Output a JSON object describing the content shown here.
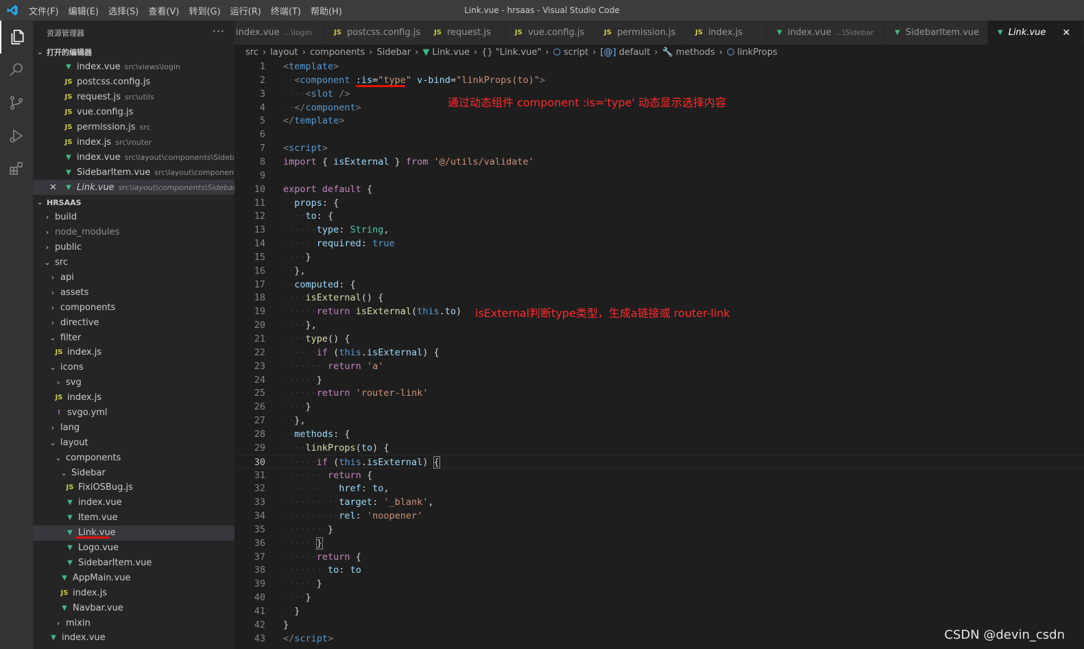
{
  "titlebar": {
    "menu": [
      "文件(F)",
      "编辑(E)",
      "选择(S)",
      "查看(V)",
      "转到(G)",
      "运行(R)",
      "终端(T)",
      "帮助(H)"
    ],
    "title": "Link.vue - hrsaas - Visual Studio Code"
  },
  "sidebar": {
    "title": "资源管理器",
    "more": "···",
    "open_editors_label": "打开的编辑器",
    "open_editors": [
      {
        "icon": "vue",
        "name": "index.vue",
        "desc": "src\\views\\login"
      },
      {
        "icon": "js",
        "name": "postcss.config.js",
        "desc": ""
      },
      {
        "icon": "js",
        "name": "request.js",
        "desc": "src\\utils"
      },
      {
        "icon": "js",
        "name": "vue.config.js",
        "desc": ""
      },
      {
        "icon": "js",
        "name": "permission.js",
        "desc": "src"
      },
      {
        "icon": "js",
        "name": "index.js",
        "desc": "src\\router"
      },
      {
        "icon": "vue",
        "name": "index.vue",
        "desc": "src\\layout\\components\\Sidebar"
      },
      {
        "icon": "vue",
        "name": "SidebarItem.vue",
        "desc": "src\\layout\\components\\..."
      },
      {
        "icon": "vue",
        "name": "Link.vue",
        "desc": "src\\layout\\components\\Sidebar",
        "active": true
      }
    ],
    "project_label": "HRSAAS",
    "tree": [
      {
        "indent": 0,
        "chev": "›",
        "name": "build"
      },
      {
        "indent": 0,
        "chev": "›",
        "name": "node_modules",
        "dim": true
      },
      {
        "indent": 0,
        "chev": "›",
        "name": "public"
      },
      {
        "indent": 0,
        "chev": "⌄",
        "name": "src"
      },
      {
        "indent": 1,
        "chev": "›",
        "name": "api"
      },
      {
        "indent": 1,
        "chev": "›",
        "name": "assets"
      },
      {
        "indent": 1,
        "chev": "›",
        "name": "components"
      },
      {
        "indent": 1,
        "chev": "›",
        "name": "directive"
      },
      {
        "indent": 1,
        "chev": "⌄",
        "name": "filter"
      },
      {
        "indent": 2,
        "icon": "js",
        "name": "index.js"
      },
      {
        "indent": 1,
        "chev": "⌄",
        "name": "icons"
      },
      {
        "indent": 2,
        "chev": "›",
        "name": "svg"
      },
      {
        "indent": 2,
        "icon": "js",
        "name": "index.js"
      },
      {
        "indent": 2,
        "icon": "yml",
        "name": "svgo.yml"
      },
      {
        "indent": 1,
        "chev": "›",
        "name": "lang"
      },
      {
        "indent": 1,
        "chev": "⌄",
        "name": "layout"
      },
      {
        "indent": 2,
        "chev": "⌄",
        "name": "components"
      },
      {
        "indent": 3,
        "chev": "⌄",
        "name": "Sidebar"
      },
      {
        "indent": 4,
        "icon": "js",
        "name": "FixiOSBug.js"
      },
      {
        "indent": 4,
        "icon": "vue",
        "name": "index.vue"
      },
      {
        "indent": 4,
        "icon": "vue",
        "name": "Item.vue"
      },
      {
        "indent": 4,
        "icon": "vue",
        "name": "Link.vue",
        "selected": true
      },
      {
        "indent": 4,
        "icon": "vue",
        "name": "Logo.vue"
      },
      {
        "indent": 4,
        "icon": "vue",
        "name": "SidebarItem.vue"
      },
      {
        "indent": 3,
        "icon": "vue",
        "name": "AppMain.vue"
      },
      {
        "indent": 3,
        "icon": "js",
        "name": "index.js"
      },
      {
        "indent": 3,
        "icon": "vue",
        "name": "Navbar.vue"
      },
      {
        "indent": 2,
        "chev": "›",
        "name": "mixin"
      },
      {
        "indent": 1,
        "icon": "vue",
        "name": "index.vue"
      }
    ]
  },
  "tabs": [
    {
      "icon": "",
      "name": "index.vue",
      "desc": "...\\login"
    },
    {
      "icon": "js",
      "name": "postcss.config.js",
      "desc": ""
    },
    {
      "icon": "js",
      "name": "request.js",
      "desc": ""
    },
    {
      "icon": "js",
      "name": "vue.config.js",
      "desc": ""
    },
    {
      "icon": "js",
      "name": "permission.js",
      "desc": ""
    },
    {
      "icon": "js",
      "name": "index.js",
      "desc": ""
    },
    {
      "icon": "vue",
      "name": "index.vue",
      "desc": "...\\Sidebar"
    },
    {
      "icon": "vue",
      "name": "SidebarItem.vue",
      "desc": ""
    },
    {
      "icon": "vue",
      "name": "Link.vue",
      "desc": "",
      "active": true,
      "close": "✕"
    }
  ],
  "breadcrumb": [
    {
      "label": "src"
    },
    {
      "label": "layout"
    },
    {
      "label": "components"
    },
    {
      "label": "Sidebar"
    },
    {
      "label": "Link.vue",
      "icon": "vue"
    },
    {
      "label": "\"Link.vue\"",
      "icon": "{}"
    },
    {
      "label": "script",
      "icon": "⬡"
    },
    {
      "label": "default",
      "icon": "[@]"
    },
    {
      "label": "methods",
      "icon": "🔧"
    },
    {
      "label": "linkProps",
      "icon": "⬡"
    }
  ],
  "editor": {
    "current_line": 30,
    "lines": [
      [
        [
          "t-punc",
          "<"
        ],
        [
          "t-tag",
          "template"
        ],
        [
          "t-punc",
          ">"
        ]
      ],
      [
        [
          "t-ws",
          "··"
        ],
        [
          "t-punc",
          "<"
        ],
        [
          "t-tag",
          "component"
        ],
        [
          "t-plain",
          " "
        ],
        [
          "t-attr",
          ":is"
        ],
        [
          "t-plain",
          "="
        ],
        [
          "t-str",
          "\"type\""
        ],
        [
          "t-plain",
          " "
        ],
        [
          "t-attr",
          "v-bind"
        ],
        [
          "t-plain",
          "="
        ],
        [
          "t-str",
          "\"linkProps(to)\""
        ],
        [
          "t-punc",
          ">"
        ]
      ],
      [
        [
          "t-ws",
          "····"
        ],
        [
          "t-punc",
          "<"
        ],
        [
          "t-tag",
          "slot"
        ],
        [
          "t-plain",
          " "
        ],
        [
          "t-punc",
          "/>"
        ]
      ],
      [
        [
          "t-ws",
          "··"
        ],
        [
          "t-punc",
          "</"
        ],
        [
          "t-tag",
          "component"
        ],
        [
          "t-punc",
          ">"
        ]
      ],
      [
        [
          "t-punc",
          "</"
        ],
        [
          "t-tag",
          "template"
        ],
        [
          "t-punc",
          ">"
        ]
      ],
      [],
      [
        [
          "t-punc",
          "<"
        ],
        [
          "t-tag",
          "script"
        ],
        [
          "t-punc",
          ">"
        ]
      ],
      [
        [
          "t-kw",
          "import"
        ],
        [
          "t-plain",
          " { "
        ],
        [
          "t-key",
          "isExternal"
        ],
        [
          "t-plain",
          " } "
        ],
        [
          "t-kw",
          "from"
        ],
        [
          "t-plain",
          " "
        ],
        [
          "t-str",
          "'@/utils/validate'"
        ]
      ],
      [],
      [
        [
          "t-kw",
          "export"
        ],
        [
          "t-plain",
          " "
        ],
        [
          "t-kw",
          "default"
        ],
        [
          "t-plain",
          " {"
        ]
      ],
      [
        [
          "t-ws",
          "··"
        ],
        [
          "t-key",
          "props"
        ],
        [
          "t-plain",
          ": {"
        ]
      ],
      [
        [
          "t-ws",
          "····"
        ],
        [
          "t-key",
          "to"
        ],
        [
          "t-plain",
          ": {"
        ]
      ],
      [
        [
          "t-ws",
          "······"
        ],
        [
          "t-key",
          "type"
        ],
        [
          "t-plain",
          ": "
        ],
        [
          "t-type",
          "String"
        ],
        [
          "t-plain",
          ","
        ]
      ],
      [
        [
          "t-ws",
          "······"
        ],
        [
          "t-key",
          "required"
        ],
        [
          "t-plain",
          ": "
        ],
        [
          "t-bool",
          "true"
        ]
      ],
      [
        [
          "t-ws",
          "····"
        ],
        [
          "t-plain",
          "}"
        ]
      ],
      [
        [
          "t-ws",
          "··"
        ],
        [
          "t-plain",
          "},"
        ]
      ],
      [
        [
          "t-ws",
          "··"
        ],
        [
          "t-key",
          "computed"
        ],
        [
          "t-plain",
          ": {"
        ]
      ],
      [
        [
          "t-ws",
          "····"
        ],
        [
          "t-fn",
          "isExternal"
        ],
        [
          "t-plain",
          "() {"
        ]
      ],
      [
        [
          "t-ws",
          "······"
        ],
        [
          "t-kw",
          "return"
        ],
        [
          "t-plain",
          " "
        ],
        [
          "t-fn",
          "isExternal"
        ],
        [
          "t-plain",
          "("
        ],
        [
          "t-this",
          "this"
        ],
        [
          "t-plain",
          "."
        ],
        [
          "t-key",
          "to"
        ],
        [
          "t-plain",
          ")"
        ]
      ],
      [
        [
          "t-ws",
          "····"
        ],
        [
          "t-plain",
          "},"
        ]
      ],
      [
        [
          "t-ws",
          "····"
        ],
        [
          "t-fn",
          "type"
        ],
        [
          "t-plain",
          "() {"
        ]
      ],
      [
        [
          "t-ws",
          "······"
        ],
        [
          "t-kw",
          "if"
        ],
        [
          "t-plain",
          " ("
        ],
        [
          "t-this",
          "this"
        ],
        [
          "t-plain",
          "."
        ],
        [
          "t-key",
          "isExternal"
        ],
        [
          "t-plain",
          ") {"
        ]
      ],
      [
        [
          "t-ws",
          "········"
        ],
        [
          "t-kw",
          "return"
        ],
        [
          "t-plain",
          " "
        ],
        [
          "t-str",
          "'a'"
        ]
      ],
      [
        [
          "t-ws",
          "······"
        ],
        [
          "t-plain",
          "}"
        ]
      ],
      [
        [
          "t-ws",
          "······"
        ],
        [
          "t-kw",
          "return"
        ],
        [
          "t-plain",
          " "
        ],
        [
          "t-str",
          "'router-link'"
        ]
      ],
      [
        [
          "t-ws",
          "····"
        ],
        [
          "t-plain",
          "}"
        ]
      ],
      [
        [
          "t-ws",
          "··"
        ],
        [
          "t-plain",
          "},"
        ]
      ],
      [
        [
          "t-ws",
          "··"
        ],
        [
          "t-key",
          "methods"
        ],
        [
          "t-plain",
          ": {"
        ]
      ],
      [
        [
          "t-ws",
          "····"
        ],
        [
          "t-fn",
          "linkProps"
        ],
        [
          "t-plain",
          "("
        ],
        [
          "t-key",
          "to"
        ],
        [
          "t-plain",
          ") {"
        ]
      ],
      [
        [
          "t-ws",
          "······"
        ],
        [
          "t-kw",
          "if"
        ],
        [
          "t-plain",
          " ("
        ],
        [
          "t-this",
          "this"
        ],
        [
          "t-plain",
          "."
        ],
        [
          "t-key",
          "isExternal"
        ],
        [
          "t-plain",
          ") "
        ],
        [
          "t-plain bracket-box",
          "{"
        ]
      ],
      [
        [
          "t-ws",
          "········"
        ],
        [
          "t-kw",
          "return"
        ],
        [
          "t-plain",
          " {"
        ]
      ],
      [
        [
          "t-ws",
          "··········"
        ],
        [
          "t-key",
          "href"
        ],
        [
          "t-plain",
          ": "
        ],
        [
          "t-key",
          "to"
        ],
        [
          "t-plain",
          ","
        ]
      ],
      [
        [
          "t-ws",
          "··········"
        ],
        [
          "t-key",
          "target"
        ],
        [
          "t-plain",
          ": "
        ],
        [
          "t-str",
          "'_blank'"
        ],
        [
          "t-plain",
          ","
        ]
      ],
      [
        [
          "t-ws",
          "··········"
        ],
        [
          "t-key",
          "rel"
        ],
        [
          "t-plain",
          ": "
        ],
        [
          "t-str",
          "'noopener'"
        ]
      ],
      [
        [
          "t-ws",
          "········"
        ],
        [
          "t-plain",
          "}"
        ]
      ],
      [
        [
          "t-ws",
          "······"
        ],
        [
          "t-plain bracket-box",
          "}"
        ]
      ],
      [
        [
          "t-ws",
          "······"
        ],
        [
          "t-kw",
          "return"
        ],
        [
          "t-plain",
          " {"
        ]
      ],
      [
        [
          "t-ws",
          "········"
        ],
        [
          "t-key",
          "to"
        ],
        [
          "t-plain",
          ": "
        ],
        [
          "t-key",
          "to"
        ]
      ],
      [
        [
          "t-ws",
          "······"
        ],
        [
          "t-plain",
          "}"
        ]
      ],
      [
        [
          "t-ws",
          "····"
        ],
        [
          "t-plain",
          "}"
        ]
      ],
      [
        [
          "t-ws",
          "··"
        ],
        [
          "t-plain",
          "}"
        ]
      ],
      [
        [
          "t-plain",
          "}"
        ]
      ],
      [
        [
          "t-punc",
          "</"
        ],
        [
          "t-tag",
          "script"
        ],
        [
          "t-punc",
          ">"
        ]
      ]
    ]
  },
  "annotations": {
    "note1": "通过动态组件 component :is='type' 动态显示选择内容",
    "note2": "isExternal判断type类型，生成a链接或 router-link"
  },
  "watermark": "CSDN @devin_csdn",
  "colors": {
    "annotation": "#ff2b2b",
    "underline": "#e51400",
    "accent": "#007acc"
  }
}
